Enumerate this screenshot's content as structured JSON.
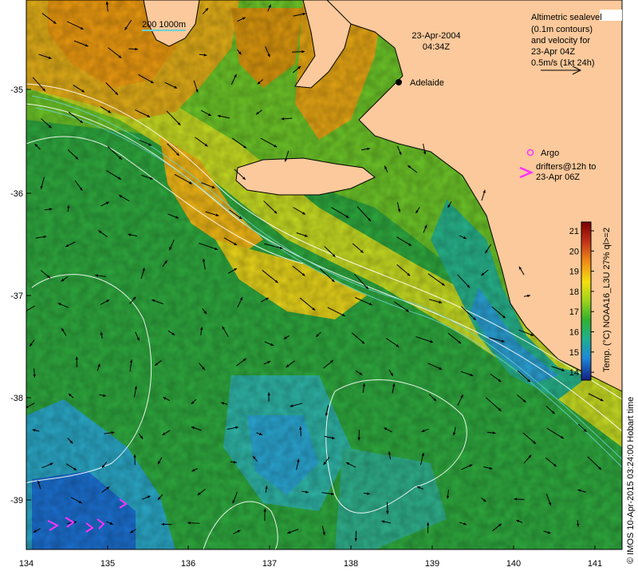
{
  "map": {
    "date_title": "23-Apr-2004",
    "time_title": "04:34Z",
    "scale_label": "200 1000m",
    "city": "Adelaide",
    "legend_lines": [
      "Altimetric sealevel",
      "(0.1m contours)",
      "and velocity for",
      "23-Apr 04Z",
      "0.5m/s (1kt 24h)"
    ],
    "argo_label": "Argo",
    "drifter_lines": [
      "drifters@12h to",
      "23-Apr 06Z"
    ],
    "colorbar_label": "Temp. (°C) NOAA16_L3U 27% ql>=2",
    "colorbar_ticks": [
      "21",
      "20",
      "19",
      "18",
      "17",
      "16",
      "15",
      "14"
    ],
    "credit": "© IMOS 10-Apr-2015 03:24:00 Hobart time",
    "lat_ticks": [
      "-35",
      "-36",
      "-37",
      "-38",
      "-39"
    ],
    "lon_ticks": [
      "134",
      "135",
      "136",
      "137",
      "138",
      "139",
      "140",
      "141"
    ],
    "colors": {
      "land": "#fbc99b",
      "warm": "#e8a313",
      "mid": "#8fd21e",
      "cool": "#20a84a",
      "cold": "#2fa7d8",
      "contour": "#ffffff",
      "isobath": "#6ad0d0",
      "drifter": "#ff33ff"
    }
  }
}
